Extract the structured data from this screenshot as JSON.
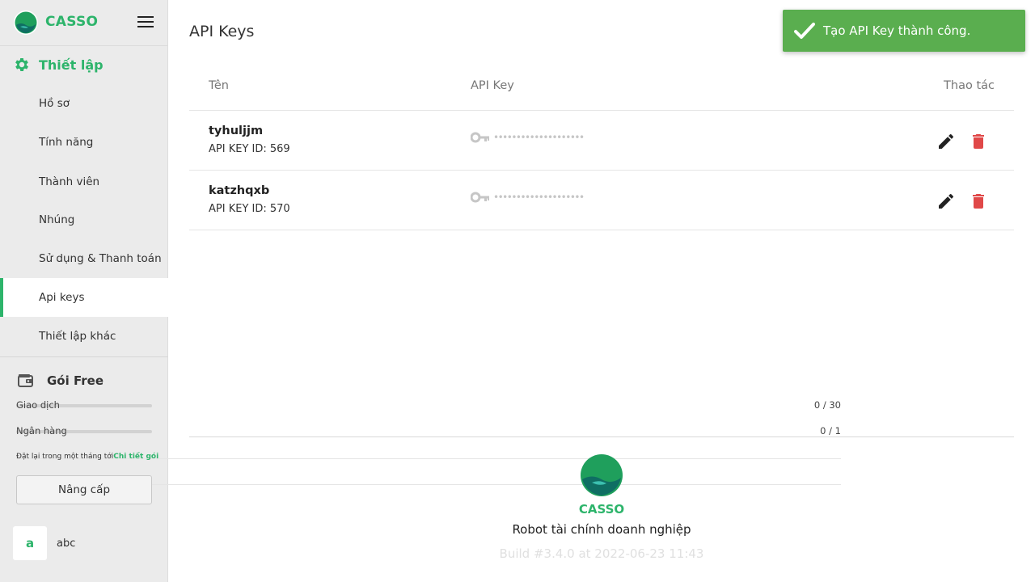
{
  "brand": {
    "name": "CASSO"
  },
  "sidebar": {
    "section_title": "Thiết lập",
    "items": [
      {
        "label": "Hồ sơ",
        "active": false
      },
      {
        "label": "Tính năng",
        "active": false
      },
      {
        "label": "Thành viên",
        "active": false
      },
      {
        "label": "Nhúng",
        "active": false
      },
      {
        "label": "Sử dụng & Thanh toán",
        "active": false
      },
      {
        "label": "Api keys",
        "active": true
      },
      {
        "label": "Thiết lập khác",
        "active": false
      }
    ],
    "plan": {
      "title": "Gói Free",
      "usage": [
        {
          "label": "Giao dịch",
          "value": "0 / 30",
          "fraction": 0
        },
        {
          "label": "Ngân hàng",
          "value": "0 / 1",
          "fraction": 0
        }
      ],
      "reset_note": "Đặt lại trong một tháng tới",
      "reset_link": "Chi tiết gói",
      "upgrade_label": "Nâng cấp"
    },
    "user": {
      "avatar_letter": "a",
      "name": "abc"
    }
  },
  "main": {
    "title": "API Keys",
    "columns": {
      "name": "Tên",
      "key": "API Key",
      "actions": "Thao tác"
    },
    "rows": [
      {
        "name": "tyhuljjm",
        "id_label": "API KEY ID: 569",
        "masked": "••••••••••••••••••••"
      },
      {
        "name": "katzhqxb",
        "id_label": "API KEY ID: 570",
        "masked": "••••••••••••••••••••"
      }
    ]
  },
  "footer": {
    "brand": "CASSO",
    "tagline": "Robot tài chính doanh nghiệp",
    "build": "Build #3.4.0 at 2022-06-23 11:43"
  },
  "toast": {
    "message": "Tạo API Key thành công."
  },
  "colors": {
    "accent": "#2db46b",
    "toast": "#5aae4f",
    "danger": "#e04848"
  }
}
